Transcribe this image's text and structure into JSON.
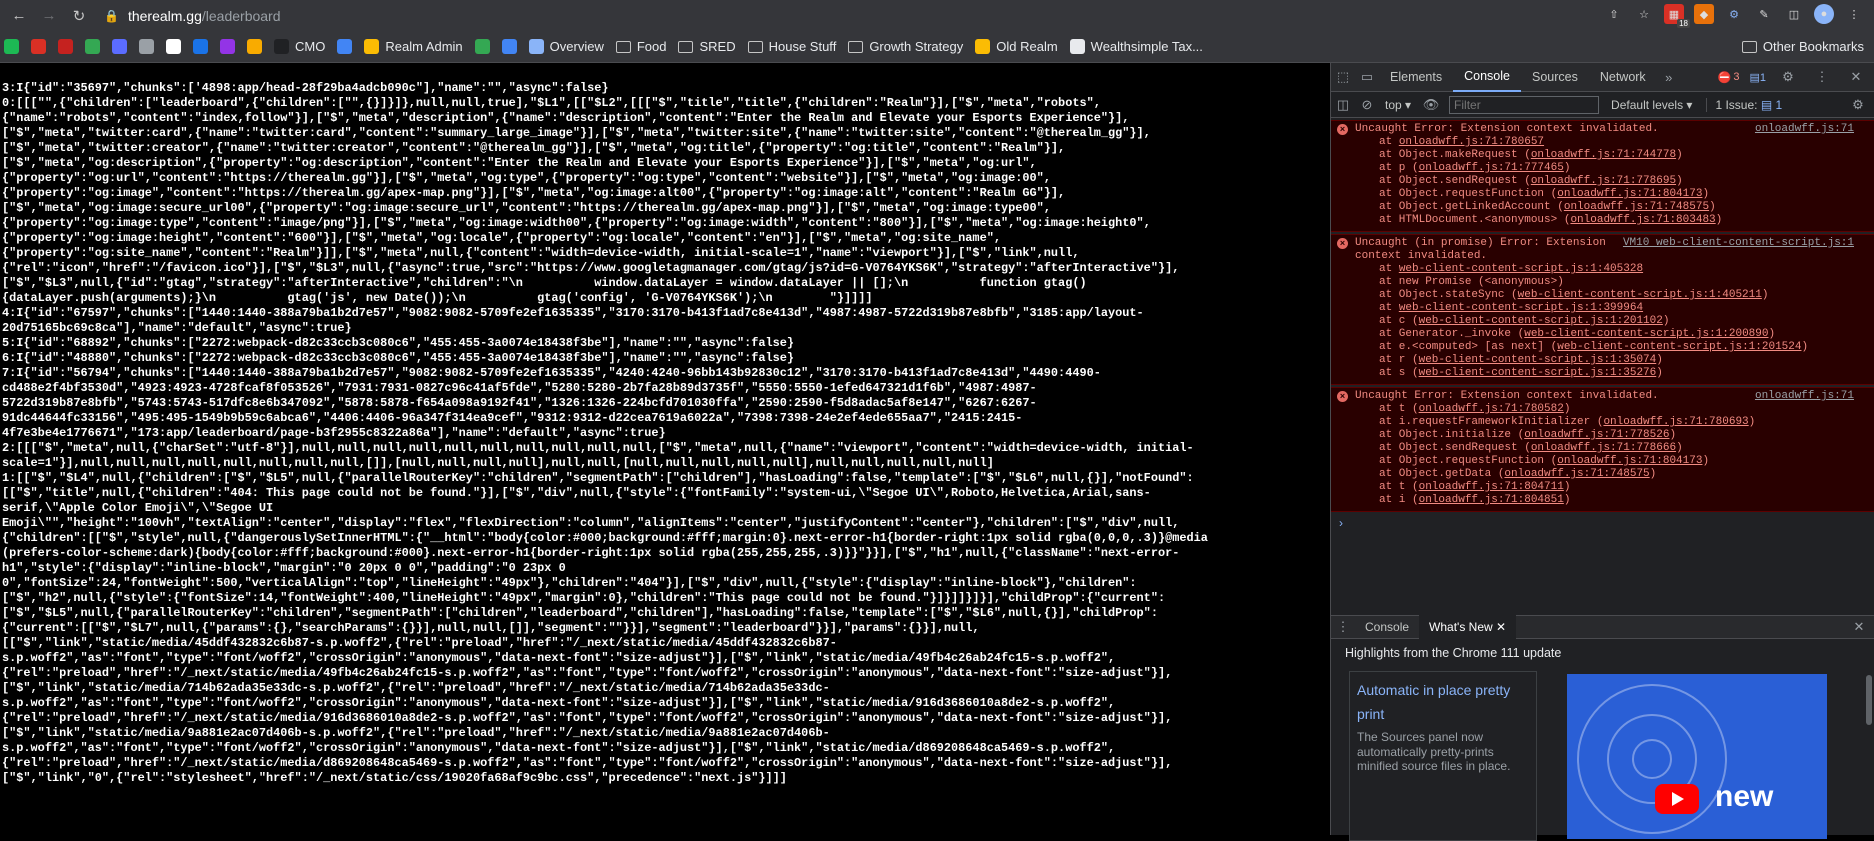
{
  "browser": {
    "url_host": "therealm.gg",
    "url_path": "/leaderboard",
    "back_icon": "arrow-left",
    "forward_icon": "arrow-right",
    "reload_icon": "reload",
    "extension_badge": "18"
  },
  "bookmarks": [
    {
      "label": "",
      "color": "#1db954"
    },
    {
      "label": "",
      "color": "#d93025"
    },
    {
      "label": "",
      "color": "#c5221f"
    },
    {
      "label": "",
      "color": "#34a853"
    },
    {
      "label": "",
      "color": "#5b6cff"
    },
    {
      "label": "",
      "color": "#9aa0a6"
    },
    {
      "label": "",
      "color": "#ffffff"
    },
    {
      "label": "",
      "color": "#1a73e8"
    },
    {
      "label": "",
      "color": "#9334e6"
    },
    {
      "label": "",
      "color": "#f9ab00"
    },
    {
      "label": "CMO",
      "color": "#202124"
    },
    {
      "label": "",
      "color": "#4285f4"
    },
    {
      "label": "Realm Admin",
      "color": "#fbbc04"
    },
    {
      "label": "",
      "color": "#34a853"
    },
    {
      "label": "",
      "color": "#4285f4"
    },
    {
      "label": "Overview",
      "color": "#8ab4f8"
    },
    {
      "label": "Food",
      "folder": true
    },
    {
      "label": "SRED",
      "folder": true
    },
    {
      "label": "House Stuff",
      "folder": true
    },
    {
      "label": "Growth Strategy",
      "folder": true
    },
    {
      "label": "Old Realm",
      "color": "#fbbc04"
    },
    {
      "label": "Wealthsimple Tax...",
      "color": "#e8eaed"
    }
  ],
  "other_bookmarks": "Other Bookmarks",
  "page_source_lines": [
    "3:I{\"id\":\"35697\",\"chunks\":['4898:app/head-28f29ba4adcb090c\"],\"name\":\"\",\"async\":false}",
    "0:[[[\"\",{\"children\":[\"leaderboard\",{\"children\":[\"\",{}]}]},null,null,true],\"$L1\",[[\"$L2\",[[[\"$\",\"title\",\"title\",{\"children\":\"Realm\"}],[\"$\",\"meta\",\"robots\",",
    "{\"name\":\"robots\",\"content\":\"index,follow\"}],[\"$\",\"meta\",\"description\",{\"name\":\"description\",\"content\":\"Enter the Realm and Elevate your Esports Experience\"}],",
    "[\"$\",\"meta\",\"twitter:card\",{\"name\":\"twitter:card\",\"content\":\"summary_large_image\"}],[\"$\",\"meta\",\"twitter:site\",{\"name\":\"twitter:site\",\"content\":\"@therealm_gg\"}],",
    "[\"$\",\"meta\",\"twitter:creator\",{\"name\":\"twitter:creator\",\"content\":\"@therealm_gg\"}],[\"$\",\"meta\",\"og:title\",{\"property\":\"og:title\",\"content\":\"Realm\"}],",
    "[\"$\",\"meta\",\"og:description\",{\"property\":\"og:description\",\"content\":\"Enter the Realm and Elevate your Esports Experience\"}],[\"$\",\"meta\",\"og:url\",",
    "{\"property\":\"og:url\",\"content\":\"https://therealm.gg\"}],[\"$\",\"meta\",\"og:type\",{\"property\":\"og:type\",\"content\":\"website\"}],[\"$\",\"meta\",\"og:image:00\",",
    "{\"property\":\"og:image\",\"content\":\"https://therealm.gg/apex-map.png\"}],[\"$\",\"meta\",\"og:image:alt00\",{\"property\":\"og:image:alt\",\"content\":\"Realm GG\"}],",
    "[\"$\",\"meta\",\"og:image:secure_url00\",{\"property\":\"og:image:secure_url\",\"content\":\"https://therealm.gg/apex-map.png\"}],[\"$\",\"meta\",\"og:image:type00\",",
    "{\"property\":\"og:image:type\",\"content\":\"image/png\"}],[\"$\",\"meta\",\"og:image:width00\",{\"property\":\"og:image:width\",\"content\":\"800\"}],[\"$\",\"meta\",\"og:image:height0\",",
    "{\"property\":\"og:image:height\",\"content\":\"600\"}],[\"$\",\"meta\",\"og:locale\",{\"property\":\"og:locale\",\"content\":\"en\"}],[\"$\",\"meta\",\"og:site_name\",",
    "{\"property\":\"og:site_name\",\"content\":\"Realm\"}]],[\"$\",\"meta\",null,{\"content\":\"width=device-width, initial-scale=1\",\"name\":\"viewport\"}],[\"$\",\"link\",null,",
    "{\"rel\":\"icon\",\"href\":\"/favicon.ico\"}],[\"$\",\"$L3\",null,{\"async\":true,\"src\":\"https://www.googletagmanager.com/gtag/js?id=G-V0764YKS6K\",\"strategy\":\"afterInteractive\"}],",
    "[\"$\",\"$L3\",null,{\"id\":\"gtag\",\"strategy\":\"afterInteractive\",\"children\":\"\\n          window.dataLayer = window.dataLayer || [];\\n          function gtag()",
    "{dataLayer.push(arguments);}\\n          gtag('js', new Date());\\n          gtag('config', 'G-V0764YKS6K');\\n        \"}]]]]",
    "4:I{\"id\":\"67597\",\"chunks\":[\"1440:1440-388a79ba1b2d7e57\",\"9082:9082-5709fe2ef1635335\",\"3170:3170-b413f1ad7c8e413d\",\"4987:4987-5722d319b87e8bfb\",\"3185:app/layout-",
    "20d75165bc69c8ca\"],\"name\":\"default\",\"async\":true}",
    "5:I{\"id\":\"68892\",\"chunks\":[\"2272:webpack-d82c33ccb3c080c6\",\"455:455-3a0074e18438f3be\"],\"name\":\"\",\"async\":false}",
    "6:I{\"id\":\"48880\",\"chunks\":[\"2272:webpack-d82c33ccb3c080c6\",\"455:455-3a0074e18438f3be\"],\"name\":\"\",\"async\":false}",
    "7:I{\"id\":\"56794\",\"chunks\":[\"1440:1440-388a79ba1b2d7e57\",\"9082:9082-5709fe2ef1635335\",\"4240:4240-96bb143b92830c12\",\"3170:3170-b413f1ad7c8e413d\",\"4490:4490-",
    "cd488e2f4bf3530d\",\"4923:4923-4728fcaf8f053526\",\"7931:7931-0827c96c41af5fde\",\"5280:5280-2b7fa28b89d3735f\",\"5550:5550-1efed647321d1f6b\",\"4987:4987-",
    "5722d319b87e8bfb\",\"5743:5743-517dfc8e6b347092\",\"5878:5878-f654a098a9192f41\",\"1326:1326-224bcfd701030ffa\",\"2590:2590-f5d8adac5af8e147\",\"6267:6267-",
    "91dc44644fc33156\",\"495:495-1549b9b59c6abca6\",\"4406:4406-96a347f314ea9cef\",\"9312:9312-d22cea7619a6022a\",\"7398:7398-24e2ef4ede655aa7\",\"2415:2415-",
    "4f7e3be4e1776671\",\"173:app/leaderboard/page-b3f2955c8322a86a\"],\"name\":\"default\",\"async\":true}",
    "2:[[[\"$\",\"meta\",null,{\"charSet\":\"utf-8\"}],null,null,null,null,null,null,null,null,null,null,[\"$\",\"meta\",null,{\"name\":\"viewport\",\"content\":\"width=device-width, initial-",
    "scale=1\"}],null,null,null,null,null,null,null,null,[]],[null,null,null,null],null,null,[null,null,null,null,null],null,null,null,null,null]",
    "1:[[\"$\",\"$L4\",null,{\"children\":[\"$\",\"$L5\",null,{\"parallelRouterKey\":\"children\",\"segmentPath\":[\"children\"],\"hasLoading\":false,\"template\":[\"$\",\"$L6\",null,{}],\"notFound\":",
    "[[\"$\",\"title\",null,{\"children\":\"404: This page could not be found.\"}],[\"$\",\"div\",null,{\"style\":{\"fontFamily\":\"system-ui,\\\"Segoe UI\\\",Roboto,Helvetica,Arial,sans-",
    "serif,\\\"Apple Color Emoji\\\",\\\"Segoe UI",
    "Emoji\\\"\",\"height\":\"100vh\",\"textAlign\":\"center\",\"display\":\"flex\",\"flexDirection\":\"column\",\"alignItems\":\"center\",\"justifyContent\":\"center\"},\"children\":[\"$\",\"div\",null,",
    "{\"children\":[[\"$\",\"style\",null,{\"dangerouslySetInnerHTML\":{\"__html\":\"body{color:#000;background:#fff;margin:0}.next-error-h1{border-right:1px solid rgba(0,0,0,.3)}@media",
    "(prefers-color-scheme:dark){body{color:#fff;background:#000}.next-error-h1{border-right:1px solid rgba(255,255,255,.3)}}\"}}],[\"$\",\"h1\",null,{\"className\":\"next-error-",
    "h1\",\"style\":{\"display\":\"inline-block\",\"margin\":\"0 20px 0 0\",\"padding\":\"0 23px 0",
    "0\",\"fontSize\":24,\"fontWeight\":500,\"verticalAlign\":\"top\",\"lineHeight\":\"49px\"},\"children\":\"404\"}],[\"$\",\"div\",null,{\"style\":{\"display\":\"inline-block\"},\"children\":",
    "[\"$\",\"h2\",null,{\"style\":{\"fontSize\":14,\"fontWeight\":400,\"lineHeight\":\"49px\",\"margin\":0},\"children\":\"This page could not be found.\"}]}]]}]}],\"childProp\":{\"current\":",
    "[\"$\",\"$L5\",null,{\"parallelRouterKey\":\"children\",\"segmentPath\":[\"children\",\"leaderboard\",\"children\"],\"hasLoading\":false,\"template\":[\"$\",\"$L6\",null,{}],\"childProp\":",
    "{\"current\":[[\"$\",\"$L7\",null,{\"params\":{},\"searchParams\":{}}],null,null,[]],\"segment\":\"\"}}],\"segment\":\"leaderboard\"}}],\"params\":{}}],null,",
    "[[\"$\",\"link\",\"static/media/45ddf432832c6b87-s.p.woff2\",{\"rel\":\"preload\",\"href\":\"/_next/static/media/45ddf432832c6b87-",
    "s.p.woff2\",\"as\":\"font\",\"type\":\"font/woff2\",\"crossOrigin\":\"anonymous\",\"data-next-font\":\"size-adjust\"}],[\"$\",\"link\",\"static/media/49fb4c26ab24fc15-s.p.woff2\",",
    "{\"rel\":\"preload\",\"href\":\"/_next/static/media/49fb4c26ab24fc15-s.p.woff2\",\"as\":\"font\",\"type\":\"font/woff2\",\"crossOrigin\":\"anonymous\",\"data-next-font\":\"size-adjust\"}],",
    "[\"$\",\"link\",\"static/media/714b62ada35e33dc-s.p.woff2\",{\"rel\":\"preload\",\"href\":\"/_next/static/media/714b62ada35e33dc-",
    "s.p.woff2\",\"as\":\"font\",\"type\":\"font/woff2\",\"crossOrigin\":\"anonymous\",\"data-next-font\":\"size-adjust\"}],[\"$\",\"link\",\"static/media/916d3686010a8de2-s.p.woff2\",",
    "{\"rel\":\"preload\",\"href\":\"/_next/static/media/916d3686010a8de2-s.p.woff2\",\"as\":\"font\",\"type\":\"font/woff2\",\"crossOrigin\":\"anonymous\",\"data-next-font\":\"size-adjust\"}],",
    "[\"$\",\"link\",\"static/media/9a881e2ac07d406b-s.p.woff2\",{\"rel\":\"preload\",\"href\":\"/_next/static/media/9a881e2ac07d406b-",
    "s.p.woff2\",\"as\":\"font\",\"type\":\"font/woff2\",\"crossOrigin\":\"anonymous\",\"data-next-font\":\"size-adjust\"}],[\"$\",\"link\",\"static/media/d869208648ca5469-s.p.woff2\",",
    "{\"rel\":\"preload\",\"href\":\"/_next/static/media/d869208648ca5469-s.p.woff2\",\"as\":\"font\",\"type\":\"font/woff2\",\"crossOrigin\":\"anonymous\",\"data-next-font\":\"size-adjust\"}],",
    "[\"$\",\"link\",\"0\",{\"rel\":\"stylesheet\",\"href\":\"/_next/static/css/19020fa68af9c9bc.css\",\"precedence\":\"next.js\"}]]]"
  ],
  "devtools": {
    "tabs": [
      "Elements",
      "Console",
      "Sources",
      "Network"
    ],
    "active_tab": "Console",
    "error_count": "3",
    "info_count": "1",
    "context": "top",
    "filter_placeholder": "Filter",
    "levels": "Default levels",
    "issues": "1 Issue:",
    "issues_count": "1",
    "messages": [
      {
        "title": "Uncaught Error: Extension context invalidated.",
        "source": "onloadwff.js:71",
        "stack": [
          {
            "fn": "at ",
            "link": "onloadwff.js:71:780657"
          },
          {
            "fn": "at Object.makeRequest (",
            "link": "onloadwff.js:71:744778",
            "tail": ")"
          },
          {
            "fn": "at p (",
            "link": "onloadwff.js:71:777465",
            "tail": ")"
          },
          {
            "fn": "at Object.sendRequest (",
            "link": "onloadwff.js:71:778695",
            "tail": ")"
          },
          {
            "fn": "at Object.requestFunction (",
            "link": "onloadwff.js:71:804173",
            "tail": ")"
          },
          {
            "fn": "at Object.getLinkedAccount (",
            "link": "onloadwff.js:71:748575",
            "tail": ")"
          },
          {
            "fn": "at HTMLDocument.<anonymous> (",
            "link": "onloadwff.js:71:803483",
            "tail": ")"
          }
        ]
      },
      {
        "title": "Uncaught (in promise) Error: Extension context invalidated.",
        "source": "VM10 web-client-content-script.js:1",
        "stack": [
          {
            "fn": "at ",
            "link": "web-client-content-script.js:1:405328"
          },
          {
            "fn": "at new Promise (<anonymous>)",
            "link": ""
          },
          {
            "fn": "at Object.stateSync (",
            "link": "web-client-content-script.js:1:405211",
            "tail": ")"
          },
          {
            "fn": "at ",
            "link": "web-client-content-script.js:1:399964"
          },
          {
            "fn": "at c (",
            "link": "web-client-content-script.js:1:201102",
            "tail": ")"
          },
          {
            "fn": "at Generator._invoke (",
            "link": "web-client-content-script.js:1:200890",
            "tail": ")"
          },
          {
            "fn": "at e.<computed> [as next] (",
            "link": "web-client-content-script.js:1:201524",
            "tail": ")"
          },
          {
            "fn": "at r (",
            "link": "web-client-content-script.js:1:35074",
            "tail": ")"
          },
          {
            "fn": "at s (",
            "link": "web-client-content-script.js:1:35276",
            "tail": ")"
          }
        ]
      },
      {
        "title": "Uncaught Error: Extension context invalidated.",
        "source": "onloadwff.js:71",
        "stack": [
          {
            "fn": "at t (",
            "link": "onloadwff.js:71:780582",
            "tail": ")"
          },
          {
            "fn": "at i.requestFrameworkInitializer (",
            "link": "onloadwff.js:71:780693",
            "tail": ")"
          },
          {
            "fn": "at Object.initialize (",
            "link": "onloadwff.js:71:778526",
            "tail": ")"
          },
          {
            "fn": "at Object.sendRequest (",
            "link": "onloadwff.js:71:778666",
            "tail": ")"
          },
          {
            "fn": "at Object.requestFunction (",
            "link": "onloadwff.js:71:804173",
            "tail": ")"
          },
          {
            "fn": "at Object.getData (",
            "link": "onloadwff.js:71:748575",
            "tail": ")"
          },
          {
            "fn": "at t (",
            "link": "onloadwff.js:71:804711",
            "tail": ")"
          },
          {
            "fn": "at i (",
            "link": "onloadwff.js:71:804851",
            "tail": ")"
          }
        ]
      }
    ],
    "drawer_tabs": [
      "Console",
      "What's New"
    ],
    "whats_new_heading": "Highlights from the Chrome 111 update",
    "card_title": "Automatic in place pretty print",
    "card_text": "The Sources panel now automatically pretty-prints minified source files in place.",
    "video_text": "new"
  }
}
